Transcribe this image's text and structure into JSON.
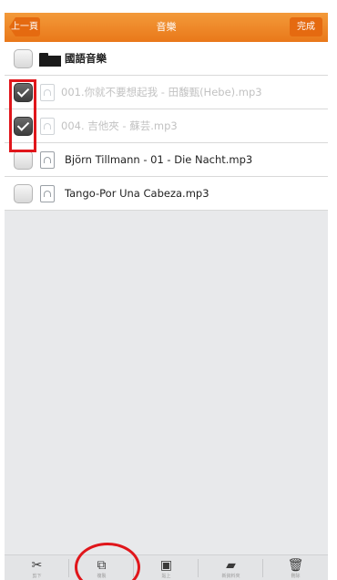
{
  "header": {
    "back_label": "上一頁",
    "title": "音樂",
    "done_label": "完成"
  },
  "items": [
    {
      "type": "folder",
      "name": "國語音樂",
      "checked": false,
      "faded": false
    },
    {
      "type": "file",
      "name": "001.你就不要想起我 - 田馥甄(Hebe).mp3",
      "checked": true,
      "faded": true
    },
    {
      "type": "file",
      "name": "004. 吉他夾 - 蘇芸.mp3",
      "checked": true,
      "faded": true
    },
    {
      "type": "file",
      "name": "Björn Tillmann - 01 - Die Nacht.mp3",
      "checked": false,
      "faded": false
    },
    {
      "type": "file",
      "name": "Tango-Por Una Cabeza.mp3",
      "checked": false,
      "faded": false
    }
  ],
  "toolbar": {
    "cut_label": "剪下",
    "copy_label": "複製",
    "paste_label": "貼上",
    "new_folder_label": "新資料夾",
    "delete_label": "刪除",
    "icons": [
      "scissors-icon",
      "copy-icon",
      "paste-icon",
      "new-folder-icon",
      "trash-icon"
    ]
  },
  "colors": {
    "header_orange": "#ee8a2b",
    "button_orange": "#e56a10",
    "highlight_red": "#e0161b"
  }
}
